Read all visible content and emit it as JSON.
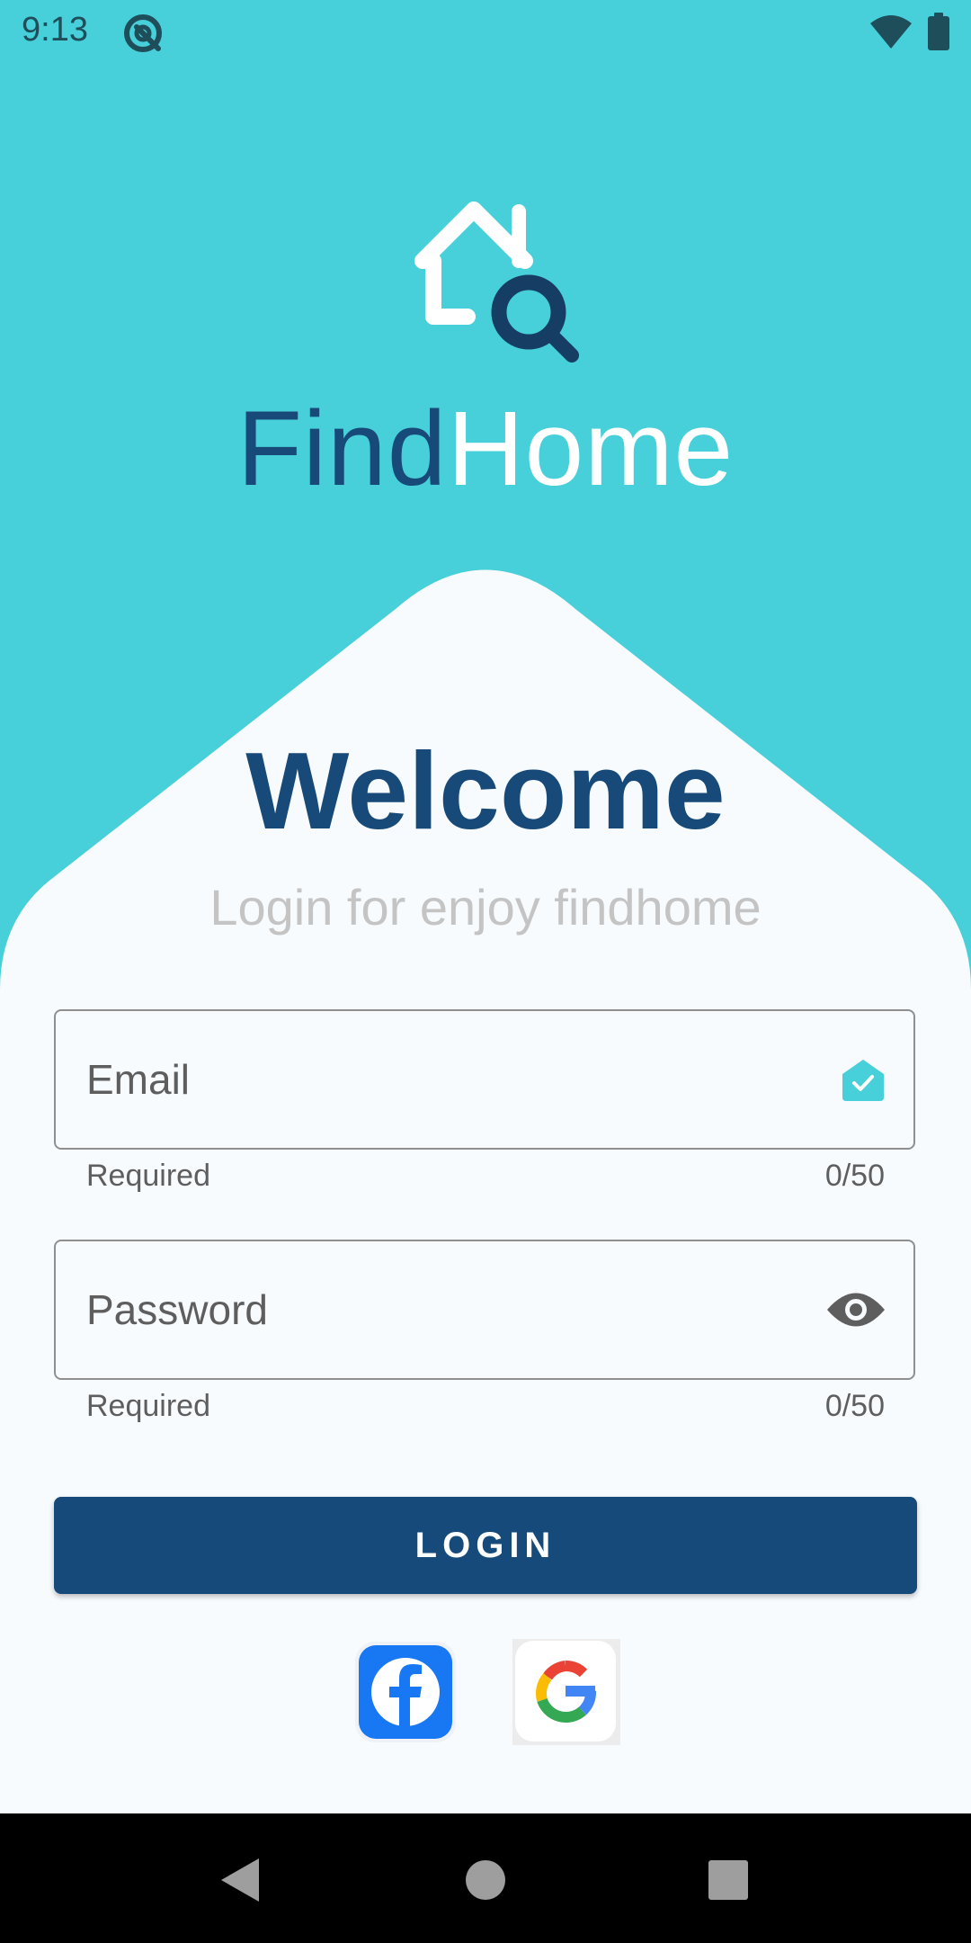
{
  "status_bar": {
    "time": "9:13"
  },
  "app": {
    "brand_part_1": "Find",
    "brand_part_2": "Home"
  },
  "welcome": {
    "title": "Welcome",
    "subtitle": "Login for enjoy findhome"
  },
  "form": {
    "email": {
      "placeholder": "Email",
      "helper": "Required",
      "counter": "0/50",
      "trailing_icon": "email-check-icon"
    },
    "password": {
      "placeholder": "Password",
      "helper": "Required",
      "counter": "0/50",
      "trailing_icon": "eye-icon"
    },
    "login_label": "LOGIN"
  },
  "social": [
    "facebook-icon",
    "google-icon"
  ],
  "colors": {
    "background": "#47D0D9",
    "primary": "#174A79",
    "card": "#F8FBFE",
    "subtitle": "#C4C4C4"
  }
}
